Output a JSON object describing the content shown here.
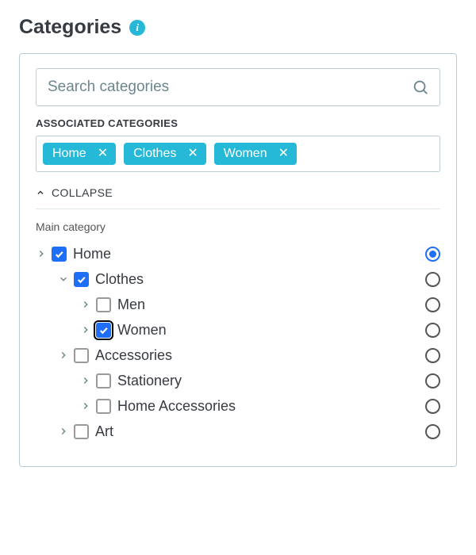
{
  "header": {
    "title": "Categories",
    "info_symbol": "i"
  },
  "search": {
    "placeholder": "Search categories"
  },
  "associated": {
    "label": "ASSOCIATED CATEGORIES",
    "tags": [
      {
        "label": "Home"
      },
      {
        "label": "Clothes"
      },
      {
        "label": "Women"
      }
    ]
  },
  "collapse": {
    "label": "COLLAPSE"
  },
  "main_category_label": "Main category",
  "tree": [
    {
      "label": "Home",
      "depth": 0,
      "expanded": false,
      "checked": true,
      "focused": false,
      "radio_selected": true
    },
    {
      "label": "Clothes",
      "depth": 1,
      "expanded": true,
      "checked": true,
      "focused": false,
      "radio_selected": false
    },
    {
      "label": "Men",
      "depth": 2,
      "expanded": false,
      "checked": false,
      "focused": false,
      "radio_selected": false
    },
    {
      "label": "Women",
      "depth": 2,
      "expanded": false,
      "checked": true,
      "focused": true,
      "radio_selected": false
    },
    {
      "label": "Accessories",
      "depth": 1,
      "expanded": false,
      "checked": false,
      "focused": false,
      "radio_selected": false
    },
    {
      "label": "Stationery",
      "depth": 2,
      "expanded": false,
      "checked": false,
      "focused": false,
      "radio_selected": false
    },
    {
      "label": "Home Accessories",
      "depth": 2,
      "expanded": false,
      "checked": false,
      "focused": false,
      "radio_selected": false
    },
    {
      "label": "Art",
      "depth": 1,
      "expanded": false,
      "checked": false,
      "focused": false,
      "radio_selected": false
    }
  ],
  "colors": {
    "accent_teal": "#25b9d7",
    "accent_blue": "#1e6ef7"
  }
}
